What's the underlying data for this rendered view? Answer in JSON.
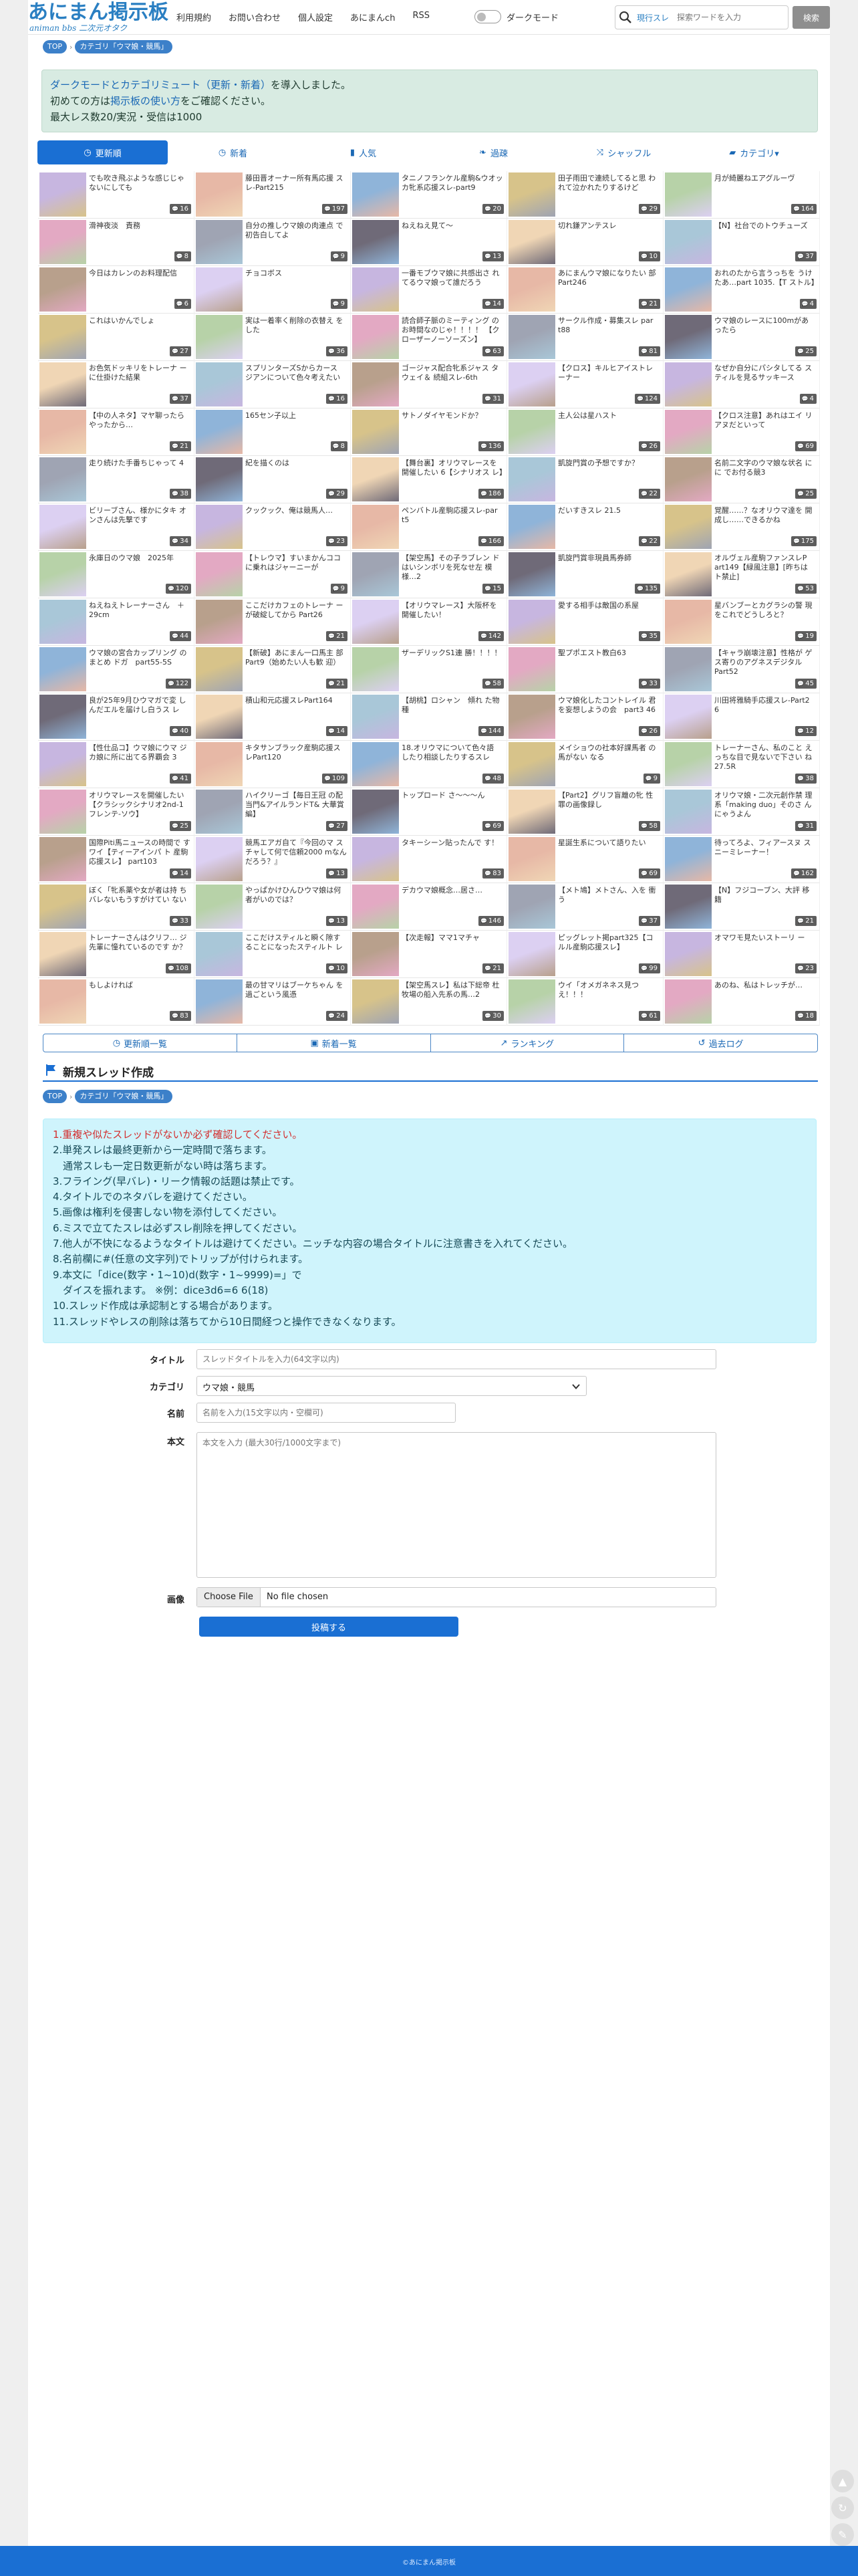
{
  "header": {
    "logo_main": "あにまん掲示板",
    "logo_sub": "animan bbs 二次元オタク",
    "nav": [
      "利用規約",
      "お問い合わせ",
      "個人設定",
      "あにまんch",
      "RSS"
    ],
    "dark_mode_label": "ダークモード",
    "search_scope": "現行スレ",
    "search_placeholder": "探索ワードを入力",
    "search_button": "検索"
  },
  "breadcrumbs": [
    "TOP",
    "カテゴリ「ウマ娘・競馬」"
  ],
  "notice": {
    "line1_link": "ダークモードとカテゴリミュート（更新・新着）",
    "line1_rest": "を導入しました。",
    "line2_pre": "初めての方は",
    "line2_link": "掲示板の使い方",
    "line2_rest": "をご確認ください。",
    "line3": "最大レス数20/実況・受信は1000"
  },
  "tabs": [
    {
      "label": "更新順",
      "icon": "clock-icon",
      "active": true
    },
    {
      "label": "新着",
      "icon": "clock-icon",
      "active": false
    },
    {
      "label": "人気",
      "icon": "bar-chart-icon",
      "active": false
    },
    {
      "label": "過疎",
      "icon": "leaf-icon",
      "active": false
    },
    {
      "label": "シャッフル",
      "icon": "shuffle-icon",
      "active": false
    },
    {
      "label": "カテゴリ▾",
      "icon": "folder-icon",
      "active": false
    }
  ],
  "threads": [
    {
      "title": "でも吹き飛ぶような感じじゃ ないにしても",
      "count": "16"
    },
    {
      "title": "藤田晋オーナー所有馬応援 スレ-Part215",
      "count": "197"
    },
    {
      "title": "タニノフランケル産駒&ウオッカ牝系応援スレ-part9",
      "count": "20"
    },
    {
      "title": "田子雨田で連続してると思 われて泣かれたりするけど",
      "count": "29"
    },
    {
      "title": "月が綺麗ねエアグルーヴ",
      "count": "164"
    },
    {
      "title": "滑神夜淡　責務",
      "count": "8"
    },
    {
      "title": "自分の推しウマ娘の肉連点 で初告白してよ",
      "count": "9"
    },
    {
      "title": "ねえねえ見て～",
      "count": "13"
    },
    {
      "title": "切れ鎌アンテスレ",
      "count": "10"
    },
    {
      "title": "【N】社台でのトウチューズ",
      "count": "37"
    },
    {
      "title": "今日はカレンのお料理配信",
      "count": "6"
    },
    {
      "title": "チョコボス",
      "count": "9"
    },
    {
      "title": "一番モブウマ娘に共感出さ れてるウマ娘って誰だろう",
      "count": "14"
    },
    {
      "title": "あにまんウマ娘になりたい 部Part246",
      "count": "21"
    },
    {
      "title": "おれのたから言うっちを うけたあ…part 1035.【T ストル】",
      "count": "4"
    },
    {
      "title": "これはいかんでしょ",
      "count": "27"
    },
    {
      "title": "実は一着率く削除の衣替え をした",
      "count": "36"
    },
    {
      "title": "読合師子脈のミーティング のお時間なのじゃ！！！！ 【クローザーノーソーズン】",
      "count": "63"
    },
    {
      "title": "サークル作成・募集スレ par t88",
      "count": "81"
    },
    {
      "title": "ウマ娘のレースに100mがあ ったら",
      "count": "25"
    },
    {
      "title": "お色気ドッキリをトレーナ ーに仕掛けた結果",
      "count": "37"
    },
    {
      "title": "スプリンターズSからカース ジアンについて色々考えたい",
      "count": "16"
    },
    {
      "title": "ゴージャス配合牝系ジャス タウェイ＆ 続組スレ-6th",
      "count": "31"
    },
    {
      "title": "【クロス】キルヒアイストレ ーナー",
      "count": "124"
    },
    {
      "title": "なぜか自分にパシタしてる スティルを見るサッキース",
      "count": "4"
    },
    {
      "title": "【中の人ネタ】マヤ聊ったら やったから…",
      "count": "21"
    },
    {
      "title": "165セン子以上",
      "count": "8"
    },
    {
      "title": "サトノダイヤモンドか？",
      "count": "136"
    },
    {
      "title": "主人公は星ハスト",
      "count": "26"
    },
    {
      "title": "【クロス注意】あれはエイ リアヌだといって",
      "count": "69"
    },
    {
      "title": "走り続けた手番ちじゃって 4",
      "count": "38"
    },
    {
      "title": "紀を描くのは",
      "count": "29"
    },
    {
      "title": "【舞台裏】オリウマレースを 開催したい 6【シナリオス レ】",
      "count": "186"
    },
    {
      "title": "凱旋門賞の予想ですか？",
      "count": "22"
    },
    {
      "title": "名前二文字のウマ娘な状名 にに でお付る競3",
      "count": "25"
    },
    {
      "title": "ビリーブさん、様かにタキ オンさんは先撃です",
      "count": "34"
    },
    {
      "title": "クックック、俺は競馬人…",
      "count": "23"
    },
    {
      "title": "ペンバトル産駒応援スレ-par t5",
      "count": "166"
    },
    {
      "title": "だいすきスレ 21.5",
      "count": "22"
    },
    {
      "title": "覚醒……？なオリウマ達を 開成し……できるかね",
      "count": "175"
    },
    {
      "title": "永庫日のウマ娘　2025年",
      "count": "120"
    },
    {
      "title": "【トレウマ】すいまかんココ に乗れはジャーニーが",
      "count": "9"
    },
    {
      "title": "【架空馬】その子ラブレン ドはいシンボリを死なせ左 模様…2",
      "count": "15"
    },
    {
      "title": "凱旋門賞非現員馬券師",
      "count": "135"
    },
    {
      "title": "オルヴェル産駒ファンスレP art149【緑風注意】[昨ちは ト禁止]",
      "count": "53"
    },
    {
      "title": "ねえねえトレーナーさん　＋ 29cm",
      "count": "44"
    },
    {
      "title": "ここだけカフェのトレーナ ーが破綻してから Part26",
      "count": "21"
    },
    {
      "title": "【オリウマレース】大阪杯を 開催したい！",
      "count": "142"
    },
    {
      "title": "愛する相手は敵国の系屋",
      "count": "35"
    },
    {
      "title": "星バンブーとカグラシの警 現をこれでどうしろと？",
      "count": "19"
    },
    {
      "title": "ウマ娘の宮合カップリング のまとめ ドガ　part55-5S",
      "count": "122"
    },
    {
      "title": "【新破】あにまん一口馬主 部Part9（始めたい人も歓 迎）",
      "count": "21"
    },
    {
      "title": "ザーデリックS1連 勝！！！！",
      "count": "58"
    },
    {
      "title": "聖プポエスト教白63",
      "count": "33"
    },
    {
      "title": "【キャラ崩壊注意】性格が ゲス寄りのアグネスデジタル Part52",
      "count": "45"
    },
    {
      "title": "良が25年9月ひウマガで変 しんだエルを届けし白うス レ",
      "count": "40"
    },
    {
      "title": "積山和元応援スレPart164",
      "count": "14"
    },
    {
      "title": "【胡桃】ロシャン　傾れ た物種",
      "count": "144"
    },
    {
      "title": "ウマ娘化したコントレイル 君を妄想しようの会　part3 46",
      "count": "26"
    },
    {
      "title": "川田将雅騎手応援スレ-Part2 6",
      "count": "12"
    },
    {
      "title": "【性仕品コ】ウマ娘にウマ ジカ娘に所に出てる界覇会 3",
      "count": "41"
    },
    {
      "title": "キタサンブラック産駒応援ス レPart120",
      "count": "109"
    },
    {
      "title": "18.オリウマについて色々語 したり相談したりするスレ",
      "count": "48"
    },
    {
      "title": "メイショウの社本好課馬者 の馬がない なる",
      "count": "9"
    },
    {
      "title": "トレーナーさん、私のこと えっちな目で見ないで下さい ね 27.5R",
      "count": "38"
    },
    {
      "title": "オリウマレースを開催したい 【クラシックシナリオ2nd-1 フレンテ-ソウ】",
      "count": "25"
    },
    {
      "title": "ハイクリーゴ【毎日王冠 の配当門&アイルランドT& 大華賞編】",
      "count": "27"
    },
    {
      "title": "トップロード さ～～～ん",
      "count": "69"
    },
    {
      "title": "【Part2】グリフ盲離の牝 性罪の画像録し",
      "count": "58"
    },
    {
      "title": "オリウマ娘・二次元創作禁 理系「making duo」そのさ んにゃうよん",
      "count": "31"
    },
    {
      "title": "国際Piti馬ニュースの時間で すワイ【ティーアインパ ト 産駒応援スレ】 part103",
      "count": "14"
    },
    {
      "title": "競馬エアガ自て『今回のマ スチャして何で信頼2000 mなんだろう？』",
      "count": "13"
    },
    {
      "title": "タキーシーン貼ったんで す！",
      "count": "83"
    },
    {
      "title": "星誕生系について語りたい",
      "count": "69"
    },
    {
      "title": "待ってろよ、フィアースヌ スニーミレーナー！",
      "count": "162"
    },
    {
      "title": "ぼく「牝系薬や女が者は持 ちバレないもうすがけてい ない",
      "count": "33"
    },
    {
      "title": "やっぱかけひんひウマ娘は何 者がいのでは？",
      "count": "13"
    },
    {
      "title": "デカウマ娘概念…居さ…",
      "count": "146"
    },
    {
      "title": "【メト鳩】メトさん、入を 衝う",
      "count": "37"
    },
    {
      "title": "【N】フジコーブン、大評 移籍",
      "count": "21"
    },
    {
      "title": "トレーナーさんはクリフ… ジ先輩に憧れているのです か？",
      "count": "108"
    },
    {
      "title": "ここだけスティルと瞬く隙す ることになったスティルト レ",
      "count": "10"
    },
    {
      "title": "【次走報】ママ1マチャ",
      "count": "21"
    },
    {
      "title": "ピッグレット掲part325【コ ルル産駒応援スレ】",
      "count": "99"
    },
    {
      "title": "オマワモ見たいストーリ ー",
      "count": "23"
    },
    {
      "title": "もしよければ",
      "count": "83"
    },
    {
      "title": "最の甘マリはブーケちゃん を過ごという風憑",
      "count": "24"
    },
    {
      "title": "【架空馬スレ】私は下総帝 杜牧場の船入先系の馬…2",
      "count": "30"
    },
    {
      "title": "ウイ「オメガネネス見つ え！！！",
      "count": "61"
    },
    {
      "title": "あのね、私はトレッチが…",
      "count": "18"
    }
  ],
  "bottom_nav": [
    {
      "label": "更新順一覧",
      "icon": "clock-icon"
    },
    {
      "label": "新着一覧",
      "icon": "new-icon"
    },
    {
      "label": "ランキング",
      "icon": "chart-icon"
    },
    {
      "label": "過去ログ",
      "icon": "history-icon"
    }
  ],
  "new_thread": {
    "heading": "新規スレッド作成",
    "rules": [
      "1.重複や似たスレッドがないか必ず確認してください。",
      "2.単発スレは最終更新から一定時間で落ちます。",
      "　通常スレも一定日数更新がない時は落ちます。",
      "3.フライング(早バレ)・リーク情報の話題は禁止です。",
      "4.タイトルでのネタバレを避けてください。",
      "5.画像は権利を侵害しない物を添付してください。",
      "6.ミスで立てたスレは必ずスレ削除を押してください。",
      "7.他人が不快になるようなタイトルは避けてください。ニッチな内容の場合タイトルに注意書きを入れてください。",
      "8.名前欄に#(任意の文字列)でトリップが付けられます。",
      "9.本文に「dice(数字・1~10)d(数字・1~9999)=」で",
      "　ダイスを振れます。 ※例：dice3d6=6 6(18)",
      "10.スレッド作成は承認制とする場合があります。",
      "11.スレッドやレスの削除は落ちてから10日間経つと操作できなくなります。"
    ],
    "fields": {
      "title_label": "タイトル",
      "title_placeholder": "スレッドタイトルを入力(64文字以内)",
      "category_label": "カテゴリ",
      "category_value": "ウマ娘・競馬",
      "name_label": "名前",
      "name_placeholder": "名前を入力(15文字以内・空欄可)",
      "body_label": "本文",
      "body_placeholder": "本文を入力 (最大30行/1000文字まで)",
      "image_label": "画像",
      "file_button": "Choose File",
      "file_status": "No file chosen",
      "submit_label": "投稿する"
    }
  },
  "footer": "©あにまん掲示板",
  "colors": {
    "accent": "#1a6fd3",
    "logo": "#2a7fc2",
    "notice_bg": "#d8ebe2",
    "rules_bg": "#cff4fc",
    "rules_red": "#d32f2f"
  }
}
